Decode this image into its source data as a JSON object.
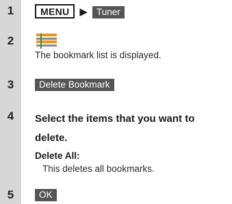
{
  "steps": [
    {
      "number": "1",
      "menu_key": "MENU",
      "arrow": "▶",
      "softkey": "Tuner"
    },
    {
      "number": "2",
      "icon": "bookmark-list-icon",
      "description": "The bookmark list is displayed."
    },
    {
      "number": "3",
      "softkey": "Delete Bookmark"
    },
    {
      "number": "4",
      "instruction_line1": "Select the items that you want to",
      "instruction_line2": "delete.",
      "option_title": "Delete All:",
      "option_description": "This deletes all bookmarks."
    },
    {
      "number": "5",
      "softkey": "OK"
    }
  ],
  "colors": {
    "sidebar": "#d7d7d7",
    "softkey_bg": "#555555",
    "softkey_text": "#ffffff",
    "icon_orange": "#e8941e"
  }
}
